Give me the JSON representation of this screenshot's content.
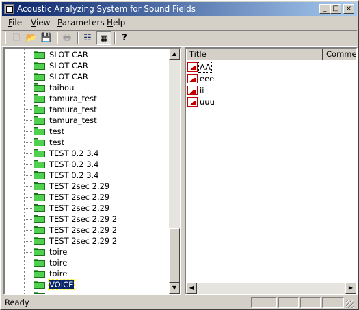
{
  "window": {
    "title": "Acoustic Analyzing System for Sound Fields",
    "controls": {
      "minimize": "_",
      "maximize": "□",
      "close": "×"
    }
  },
  "menu": [
    {
      "label": "File",
      "hotkey": "F"
    },
    {
      "label": "View",
      "hotkey": "V"
    },
    {
      "label": "Parameters",
      "hotkey": "P"
    },
    {
      "label": "Help",
      "hotkey": "H"
    }
  ],
  "toolbar": {
    "buttons": [
      {
        "name": "new-file-icon",
        "glyph": "🗋"
      },
      {
        "name": "open-folder-icon",
        "glyph": "📂"
      },
      {
        "name": "save-icon",
        "glyph": "💾"
      },
      {
        "name": "print-icon",
        "glyph": "🖶"
      },
      {
        "name": "list-view-icon",
        "glyph": "☷"
      },
      {
        "name": "details-view-icon",
        "glyph": "▦"
      },
      {
        "name": "help-icon",
        "glyph": "?"
      }
    ]
  },
  "tree": {
    "items": [
      {
        "label": "SLOT CAR"
      },
      {
        "label": "SLOT CAR"
      },
      {
        "label": "SLOT CAR"
      },
      {
        "label": "taihou"
      },
      {
        "label": "tamura_test"
      },
      {
        "label": "tamura_test"
      },
      {
        "label": "tamura_test"
      },
      {
        "label": "test"
      },
      {
        "label": "test"
      },
      {
        "label": "TEST 0.2 3.4"
      },
      {
        "label": "TEST 0.2 3.4"
      },
      {
        "label": "TEST 0.2 3.4"
      },
      {
        "label": "TEST 2sec 2.29"
      },
      {
        "label": "TEST 2sec 2.29"
      },
      {
        "label": "TEST 2sec 2.29"
      },
      {
        "label": "TEST 2sec 2.29 2"
      },
      {
        "label": "TEST 2sec 2.29 2"
      },
      {
        "label": "TEST 2sec 2.29 2"
      },
      {
        "label": "toire"
      },
      {
        "label": "toire"
      },
      {
        "label": "toire"
      },
      {
        "label": "VOICE",
        "selected": true
      },
      {
        "label": "uuuuu"
      }
    ]
  },
  "list": {
    "columns": [
      "Title",
      "Comment"
    ],
    "rows": [
      {
        "title": "AA"
      },
      {
        "title": "eee"
      },
      {
        "title": "ii"
      },
      {
        "title": "uuu"
      }
    ]
  },
  "status": {
    "text": "Ready"
  },
  "colors": {
    "titlebar_start": "#0a246a",
    "titlebar_end": "#a6caf0",
    "folder": "#4fd04f",
    "selection": "#0a246a"
  }
}
